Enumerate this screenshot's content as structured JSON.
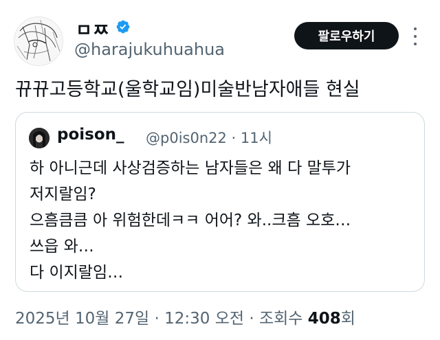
{
  "author": {
    "display_name": "ㅁㅉ",
    "handle": "@harajukuhuahua",
    "verified": true
  },
  "follow_button": {
    "label": "팔로우하기"
  },
  "tweet": {
    "text": "뀨뀨고등학교(울학교임)미술반남자애들 현실"
  },
  "quoted_tweet": {
    "display_name": "poison_",
    "handle": "@p0is0n22",
    "separator": "·",
    "time": "11시",
    "lines": [
      "하 아니근데 사상검증하는 남자들은 왜 다 말투가",
      "저지랄임?",
      "으흠큼큼 아 위험한데ㅋㅋ 어어? 와..크흠 오호…",
      "쓰읍 와…",
      "다 이지랄임…"
    ]
  },
  "meta": {
    "timestamp": "2025년 10월 27일 · 12:30 오전 · 조회수",
    "views": "408",
    "views_suffix": "회"
  },
  "colors": {
    "text": "#0f1419",
    "secondary": "#536471",
    "verified_badge": "#1d9bf0",
    "button_bg": "#0f1419",
    "border": "#cfd9de"
  }
}
